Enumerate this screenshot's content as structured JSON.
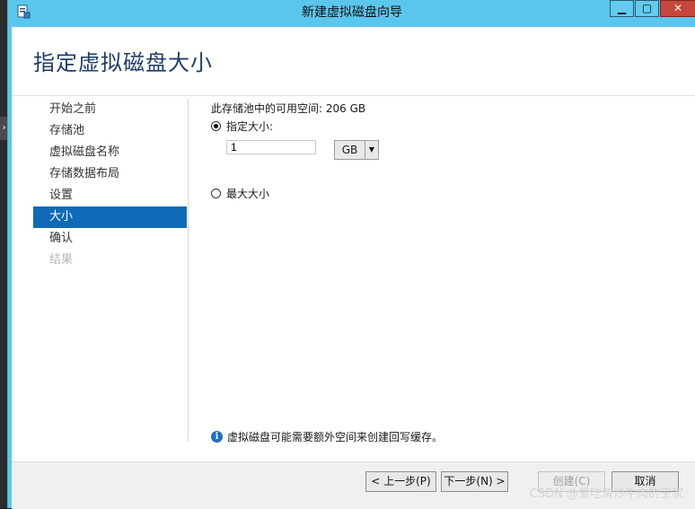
{
  "window": {
    "title": "新建虚拟磁盘向导",
    "controls": {
      "minimize": "▁",
      "maximize": "▢",
      "close": "✕"
    }
  },
  "header": {
    "title": "指定虚拟磁盘大小"
  },
  "nav": {
    "items": [
      {
        "label": "开始之前",
        "state": "normal"
      },
      {
        "label": "存储池",
        "state": "normal"
      },
      {
        "label": "虚拟磁盘名称",
        "state": "normal"
      },
      {
        "label": "存储数据布局",
        "state": "normal"
      },
      {
        "label": "设置",
        "state": "normal"
      },
      {
        "label": "大小",
        "state": "selected"
      },
      {
        "label": "确认",
        "state": "normal"
      },
      {
        "label": "结果",
        "state": "disabled"
      }
    ]
  },
  "content": {
    "available_space": "此存储池中的可用空间: 206 GB",
    "option_specify": {
      "label": "指定大小:",
      "selected": true
    },
    "size_value": "1",
    "unit": {
      "selected": "GB",
      "options": [
        "GB"
      ]
    },
    "option_max": {
      "label": "最大大小",
      "selected": false
    },
    "info": "虚拟磁盘可能需要额外空间来创建回写缓存。"
  },
  "footer": {
    "prev": "< 上一步(P)",
    "next": "下一步(N) >",
    "create": "创建(C)",
    "cancel": "取消",
    "watermark": "CSDN @爱吃清炒牛肉的王家"
  },
  "icons": {
    "info": "info-icon",
    "wizard": "wizard-icon",
    "dropdown": "chevron-down-icon"
  },
  "colors": {
    "titlebar": "#5bc6ec",
    "selection": "#0f6ab8",
    "title_text": "#1f3c6b",
    "close": "#c7463c"
  }
}
